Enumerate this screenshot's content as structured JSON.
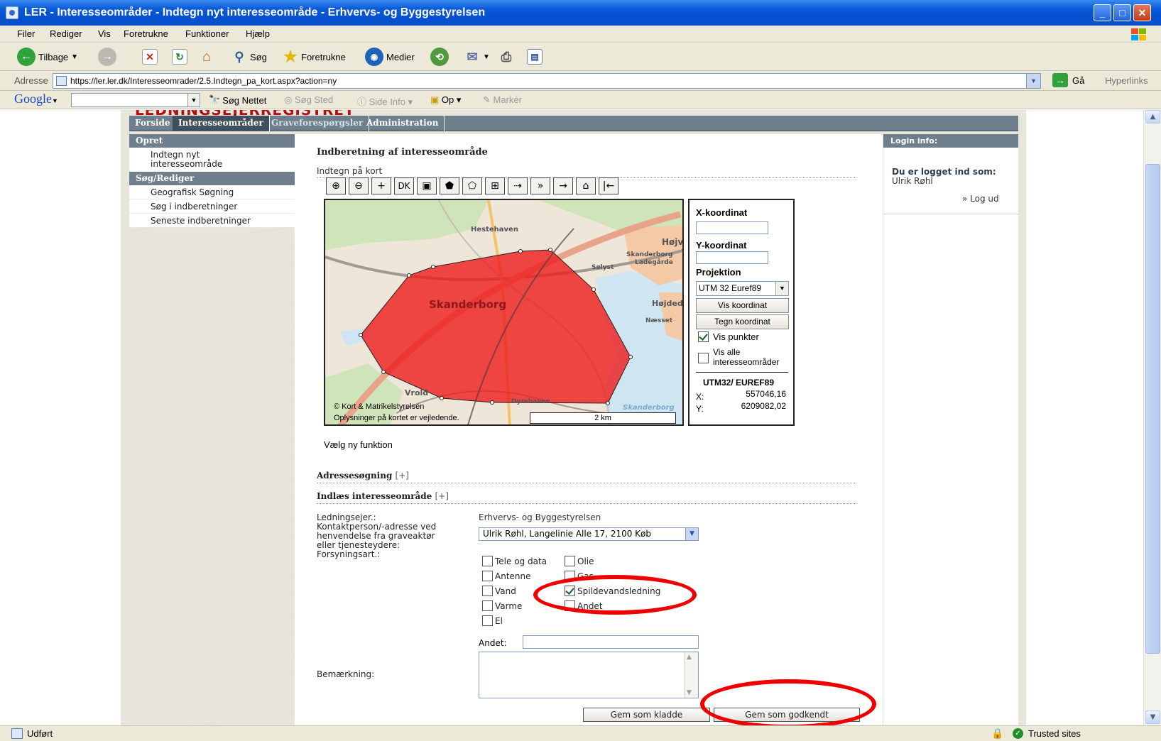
{
  "window": {
    "title": "LER - Interesseområder - Indtegn nyt interesseområde - Erhvervs- og Byggestyrelsen",
    "minimize": "_",
    "maximize": "□",
    "close": "✕"
  },
  "menu": [
    "Filer",
    "Rediger",
    "Vis",
    "Foretrukne",
    "Funktioner",
    "Hjælp"
  ],
  "toolbar": {
    "back": "Tilbage",
    "search": "Søg",
    "favorites": "Foretrukne",
    "media": "Medier"
  },
  "address": {
    "label": "Adresse",
    "url": "https://ler.ler.dk/Interesseomrader/2.5.Indtegn_pa_kort.aspx?action=ny",
    "go": "Gå",
    "links": "Hyperlinks"
  },
  "google": {
    "logo": "Google",
    "search_web": "Søg Nettet",
    "search_site": "Søg Sted",
    "page_info": "Side Info",
    "up": "Op",
    "highlight": "Markér"
  },
  "site": {
    "band_text": "LEDNINGSEJERREGISTRET",
    "tabs": [
      "Forside",
      "Interesseområder",
      "Graveforespørgsler",
      "Administration"
    ],
    "active_tab": "Interesseområder"
  },
  "leftnav": {
    "create_head": "Opret",
    "create_item_line1": "Indtegn nyt",
    "create_item_line2": "interesseområde",
    "search_head": "Søg/Rediger",
    "search_items": [
      "Geografisk Søgning",
      "Søg i indberetninger",
      "Seneste indberetninger"
    ]
  },
  "login": {
    "head": "Login info:",
    "logged_in_as": "Du er logget ind som:",
    "user": "Ulrik Røhl",
    "logout": "» Log ud"
  },
  "main": {
    "title": "Indberetning af interesseområde",
    "subtitle": "Indtegn på kort",
    "map_tools": [
      "⊕",
      "⊖",
      "+",
      "DK",
      "▣",
      "⬟",
      "⬠",
      "⊞",
      "⇢",
      "»",
      "→",
      "⌂",
      "|←"
    ],
    "map": {
      "labels": {
        "hestehaven": "Hestehaven",
        "hojvang": "Højv",
        "skanderborg_lg": "Skanderborg",
        "ladegaarde": "Ladegårde",
        "solyst": "Sølyst",
        "skanderborg": "Skanderborg",
        "hojdedal": "Højded",
        "naesset": "Næsset",
        "vrold": "Vrold",
        "dyrehaven": "Dyrehaven",
        "lake": "Skanderborg"
      },
      "copyright": "© Kort & Matrikelstyrelsen",
      "disclaimer": "Oplysninger på kortet er vejledende.",
      "scale": "2 km"
    },
    "coords": {
      "x_label": "X-koordinat",
      "y_label": "Y-koordinat",
      "projection_label": "Projektion",
      "projection_value": "UTM 32 Euref89",
      "show_btn": "Vis koordinat",
      "draw_btn": "Tegn koordinat",
      "show_points": "Vis punkter",
      "show_all_1": "Vis alle",
      "show_all_2": "interesseområder",
      "readout_title": "UTM32/ EUREF89",
      "x_prefix": "X:",
      "x_value": "557046,16",
      "y_prefix": "Y:",
      "y_value": "6209082,02"
    },
    "choose_function": "Vælg ny funktion",
    "address_search": "Adressesøgning",
    "expand": "[+]",
    "import_area": "Indlæs interesseområde",
    "owner_label": "Ledningsejer.:",
    "owner_value": "Erhvervs- og Byggestyrelsen",
    "contact_line1": "Kontaktperson/-adresse ved",
    "contact_line2": "henvendelse fra graveaktør",
    "contact_line3": "eller tjenesteydere:",
    "contact_value": "Ulrik Røhl, Langelinie Alle 17, 2100 Køb",
    "supply_label": "Forsyningsart.:",
    "supply_types": {
      "tele": "Tele og data",
      "olie": "Olie",
      "antenne": "Antenne",
      "gas": "Gas",
      "vand": "Vand",
      "spildevand": "Spildevandsledning",
      "varme": "Varme",
      "andet": "Andet",
      "el": "El"
    },
    "other_label": "Andet:",
    "remark_label": "Bemærkning:",
    "btn_draft": "Gem som kladde",
    "btn_approve": "Gem som godkendt"
  },
  "status": {
    "done": "Udført",
    "zone": "Trusted sites"
  },
  "colors": {
    "polygon": "#ee1c1c",
    "annotation": "#ee0000",
    "nav": "#6f7f8d"
  }
}
